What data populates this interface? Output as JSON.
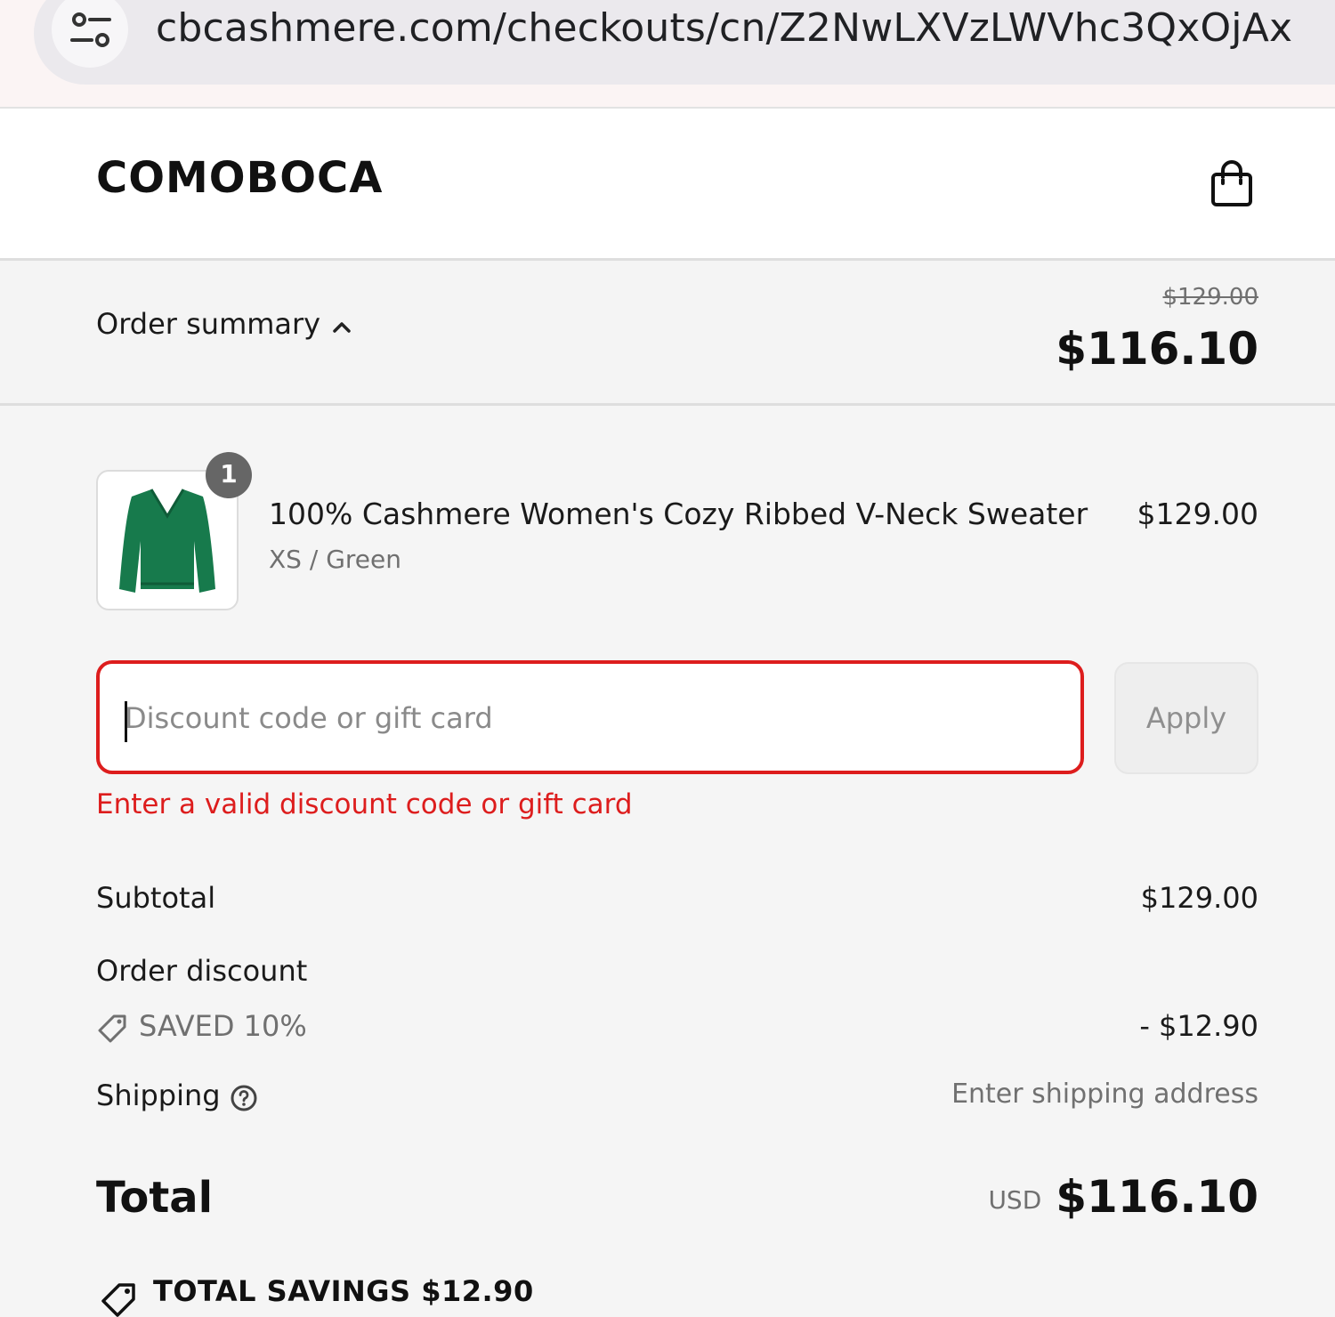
{
  "browser": {
    "url": "cbcashmere.com/checkouts/cn/Z2NwLXVzLWVhc3QxOjAx",
    "site_controls_icon": "tune-icon"
  },
  "store": {
    "logo": "COMOBOCA",
    "cart_icon": "shopping-bag-icon"
  },
  "summary": {
    "label": "Order summary",
    "original_price": "$129.00",
    "total": "$116.10"
  },
  "line_items": [
    {
      "quantity": "1",
      "title": "100% Cashmere Women's Cozy Ribbed V-Neck Sweater",
      "variant": "XS / Green",
      "price": "$129.00",
      "image_color": "#177a4c"
    }
  ],
  "discount": {
    "placeholder": "Discount code or gift card",
    "value": "",
    "apply_label": "Apply",
    "error": "Enter a valid discount code or gift card"
  },
  "totals": {
    "subtotal_label": "Subtotal",
    "subtotal_value": "$129.00",
    "order_discount_label": "Order discount",
    "saved_label": "SAVED 10%",
    "discount_value": "- $12.90",
    "shipping_label": "Shipping",
    "shipping_value": "Enter shipping address",
    "total_label": "Total",
    "currency": "USD",
    "total_value": "$116.10",
    "savings_label": "TOTAL SAVINGS  $12.90"
  },
  "colors": {
    "error": "#dd1d1d",
    "background": "#f5f5f5",
    "sweater_green": "#177a4c"
  }
}
